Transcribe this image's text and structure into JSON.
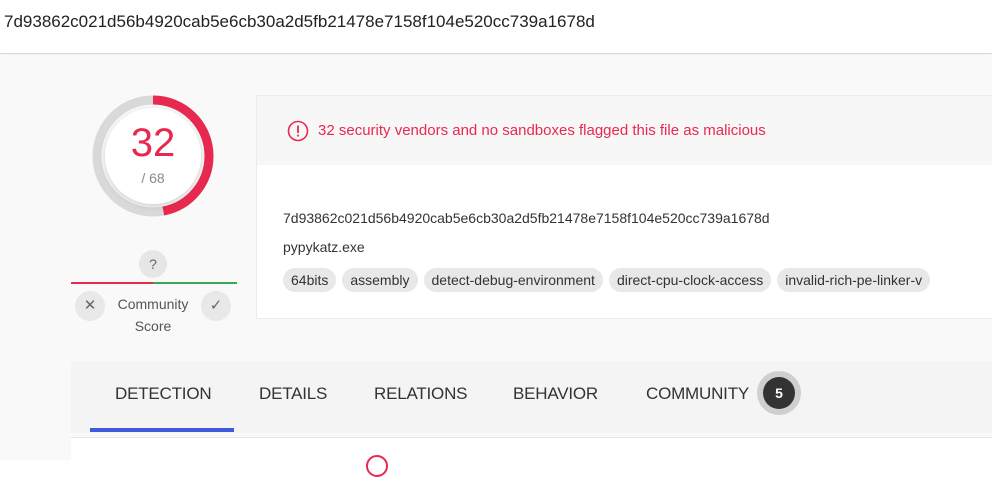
{
  "search": {
    "query": "7d93862c021d56b4920cab5e6cb30a2d5fb21478e7158f104e520cc739a1678d"
  },
  "score": {
    "detections": "32",
    "total": "/ 68",
    "detection_ratio": 0.47,
    "ring_color": "#e8294f"
  },
  "community": {
    "question_mark": "?",
    "label_line1": "Community",
    "label_line2": "Score",
    "downvote_glyph": "✕",
    "upvote_glyph": "✓",
    "negative_color": "#e8294f",
    "positive_color": "#3aa757"
  },
  "summary": {
    "alert_text": "32 security vendors and no sandboxes flagged this file as malicious",
    "hash": "7d93862c021d56b4920cab5e6cb30a2d5fb21478e7158f104e520cc739a1678d",
    "file_name": "pypykatz.exe",
    "tags": [
      "64bits",
      "assembly",
      "detect-debug-environment",
      "direct-cpu-clock-access",
      "invalid-rich-pe-linker-v"
    ]
  },
  "tabs": [
    {
      "label": "DETECTION",
      "active": true
    },
    {
      "label": "DETAILS",
      "active": false
    },
    {
      "label": "RELATIONS",
      "active": false
    },
    {
      "label": "BEHAVIOR",
      "active": false
    },
    {
      "label": "COMMUNITY",
      "active": false,
      "badge": "5"
    }
  ],
  "colors": {
    "accent": "#3f5bd9",
    "malicious": "#e8294f"
  }
}
